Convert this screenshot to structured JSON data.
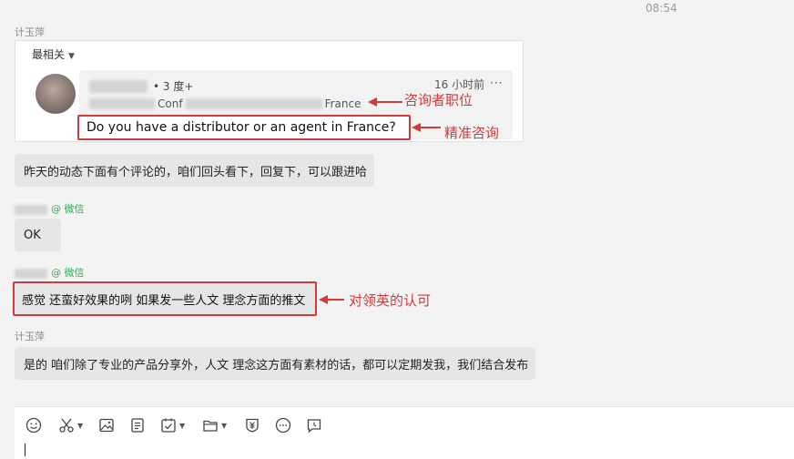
{
  "timestamp": "08:54",
  "messages": {
    "m1": {
      "sender": "计玉萍",
      "card": {
        "tab_label": "最相关",
        "commenter_degree": "• 3 度+",
        "comment_time": "16 小时前",
        "more": "···",
        "title_fragments": [
          "Conf",
          "France"
        ],
        "comment_text": "Do you have a distributor or an agent in France?",
        "annotation_title": "咨询者职位",
        "annotation_inquiry": "精准咨询"
      }
    },
    "m2": {
      "text": "昨天的动态下面有个评论的，咱们回头看下，回复下，可以跟进哈"
    },
    "m3": {
      "sender_suffix": "@ 微信",
      "text": "OK"
    },
    "m4": {
      "sender_suffix": "@ 微信",
      "text": "感觉 还蛮好效果的咧 如果发一些人文 理念方面的推文",
      "annotation": "对领英的认可"
    },
    "m5": {
      "sender": "计玉萍",
      "text": "是的 咱们除了专业的产品分享外，人文 理念这方面有素材的话，都可以定期发我，我们结合发布"
    }
  },
  "toolbar": {
    "icons": [
      "emoji-icon",
      "scissors-icon",
      "image-icon",
      "document-icon",
      "task-icon",
      "folder-icon",
      "money-icon",
      "chat-bubble-icon",
      "clock-icon"
    ]
  },
  "colors": {
    "annotation_red": "#d33a3a",
    "wechat_green": "#3aa55a",
    "bubble_gray": "#e6e6e6",
    "background": "#f3f3f3"
  }
}
